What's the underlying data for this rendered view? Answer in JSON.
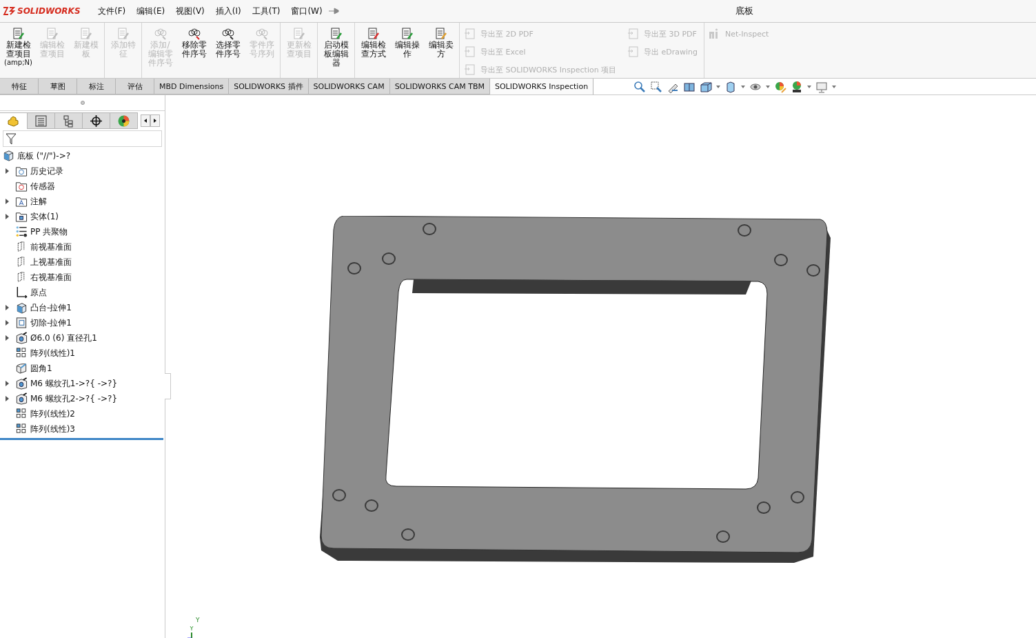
{
  "app": {
    "logo": "SOLIDWORKS",
    "document_title": "底板"
  },
  "menu": [
    "文件(F)",
    "编辑(E)",
    "视图(V)",
    "插入(I)",
    "工具(T)",
    "窗口(W)"
  ],
  "ribbon": {
    "groups": [
      {
        "buttons": [
          {
            "label": "新建检查项目",
            "shortcut": "(amp;N)",
            "disabled": false,
            "kind": "new-check"
          },
          {
            "label": "编辑检查项目",
            "disabled": true,
            "kind": "edit-check"
          },
          {
            "label": "新建模板",
            "disabled": true,
            "kind": "template"
          }
        ]
      },
      {
        "buttons": [
          {
            "label": "添加特征",
            "disabled": true,
            "kind": "feature"
          }
        ]
      },
      {
        "buttons": [
          {
            "label": "添加/编辑零件序号",
            "disabled": true,
            "kind": "balloon"
          },
          {
            "label": "移除零件序号",
            "disabled": false,
            "kind": "remove-balloon"
          },
          {
            "label": "选择零件序号",
            "disabled": false,
            "kind": "select-balloon"
          },
          {
            "label": "零件序号序列",
            "disabled": true,
            "kind": "balloon-seq"
          }
        ]
      },
      {
        "buttons": [
          {
            "label": "更新检查项目",
            "disabled": true,
            "kind": "update"
          }
        ]
      },
      {
        "buttons": [
          {
            "label": "启动模板编辑器",
            "disabled": false,
            "kind": "launch"
          }
        ]
      },
      {
        "buttons": [
          {
            "label": "编辑检查方式",
            "disabled": false,
            "kind": "edit-method"
          },
          {
            "label": "编辑操作",
            "disabled": false,
            "kind": "edit-op"
          },
          {
            "label": "编辑卖方",
            "disabled": false,
            "kind": "edit-vendor"
          }
        ]
      }
    ],
    "exports": [
      [
        "导出至 2D PDF",
        "导出至 Excel",
        "导出至 SOLIDWORKS Inspection 项目"
      ],
      [
        "导出至 3D PDF",
        "导出 eDrawing"
      ]
    ],
    "net_inspect": "Net-Inspect"
  },
  "tabs": [
    {
      "label": "特征",
      "selected": false
    },
    {
      "label": "草图",
      "selected": false
    },
    {
      "label": "标注",
      "selected": false
    },
    {
      "label": "评估",
      "selected": false
    },
    {
      "label": "MBD Dimensions",
      "selected": false
    },
    {
      "label": "SOLIDWORKS 插件",
      "selected": false
    },
    {
      "label": "SOLIDWORKS CAM",
      "selected": false
    },
    {
      "label": "SOLIDWORKS CAM TBM",
      "selected": false
    },
    {
      "label": "SOLIDWORKS Inspection",
      "selected": true
    }
  ],
  "panel_tabs": [
    {
      "kind": "feature-manager",
      "selected": true
    },
    {
      "kind": "property-manager",
      "selected": false
    },
    {
      "kind": "config-manager",
      "selected": false
    },
    {
      "kind": "dim-expert",
      "selected": false
    },
    {
      "kind": "display-manager",
      "selected": false
    }
  ],
  "tree": {
    "root": "底板 (\"//\")->?",
    "items": [
      {
        "label": "历史记录",
        "kind": "history",
        "expandable": true
      },
      {
        "label": "传感器",
        "kind": "sensor",
        "expandable": false
      },
      {
        "label": "注解",
        "kind": "annotation",
        "expandable": true
      },
      {
        "label": "实体(1)",
        "kind": "solid",
        "expandable": true
      },
      {
        "label": "PP 共聚物",
        "kind": "material",
        "expandable": false
      },
      {
        "label": "前视基准面",
        "kind": "plane",
        "expandable": false
      },
      {
        "label": "上视基准面",
        "kind": "plane",
        "expandable": false
      },
      {
        "label": "右视基准面",
        "kind": "plane",
        "expandable": false
      },
      {
        "label": "原点",
        "kind": "origin",
        "expandable": false
      },
      {
        "label": "凸台-拉伸1",
        "kind": "boss",
        "expandable": true
      },
      {
        "label": "切除-拉伸1",
        "kind": "cut",
        "expandable": true
      },
      {
        "label": "Ø6.0 (6) 直径孔1",
        "kind": "hole",
        "expandable": true
      },
      {
        "label": "阵列(线性)1",
        "kind": "pattern",
        "expandable": false
      },
      {
        "label": "圆角1",
        "kind": "fillet",
        "expandable": false
      },
      {
        "label": "M6 螺纹孔1->?{ ->?}",
        "kind": "hole",
        "expandable": true
      },
      {
        "label": "M6 螺纹孔2->?{ ->?}",
        "kind": "hole",
        "expandable": true
      },
      {
        "label": "阵列(线性)2",
        "kind": "pattern",
        "expandable": false
      },
      {
        "label": "阵列(线性)3",
        "kind": "pattern",
        "expandable": false
      }
    ]
  },
  "viewport": {
    "triad_label": "Y"
  }
}
